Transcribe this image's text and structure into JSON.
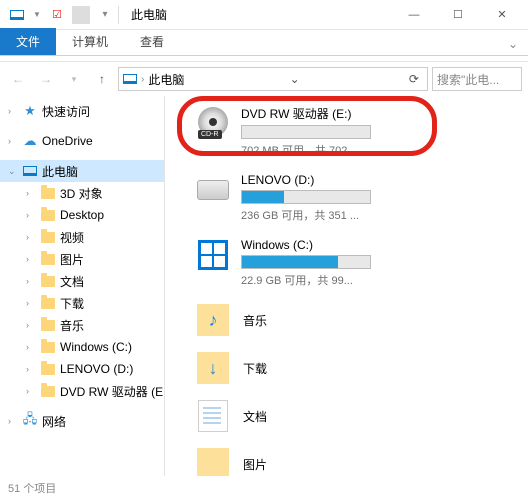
{
  "titlebar": {
    "title": "此电脑"
  },
  "tabs": {
    "file": "文件",
    "computer": "计算机",
    "view": "查看"
  },
  "address": {
    "location": "此电脑",
    "search_placeholder": "搜索\"此电..."
  },
  "sidebar": {
    "quick": "快速访问",
    "onedrive": "OneDrive",
    "thispc": "此电脑",
    "items": [
      "3D 对象",
      "Desktop",
      "视频",
      "图片",
      "文档",
      "下载",
      "音乐",
      "Windows (C:)",
      "LENOVO (D:)",
      "DVD RW 驱动器 (E"
    ],
    "network": "网络"
  },
  "drives": [
    {
      "name": "DVD RW 驱动器 (E:)",
      "space": "702 MB 可用，共 702...",
      "fill": 0,
      "type": "disc",
      "highlight": true
    },
    {
      "name": "LENOVO (D:)",
      "space": "236 GB 可用，共 351 ...",
      "fill": 33,
      "type": "hdd"
    },
    {
      "name": "Windows (C:)",
      "space": "22.9 GB 可用，共 99...",
      "fill": 75,
      "type": "win"
    }
  ],
  "libs": [
    {
      "name": "音乐",
      "icon": "music"
    },
    {
      "name": "下载",
      "icon": "download"
    },
    {
      "name": "文档",
      "icon": "doc"
    },
    {
      "name": "图片",
      "icon": "pic"
    }
  ],
  "status": "51 个项目"
}
